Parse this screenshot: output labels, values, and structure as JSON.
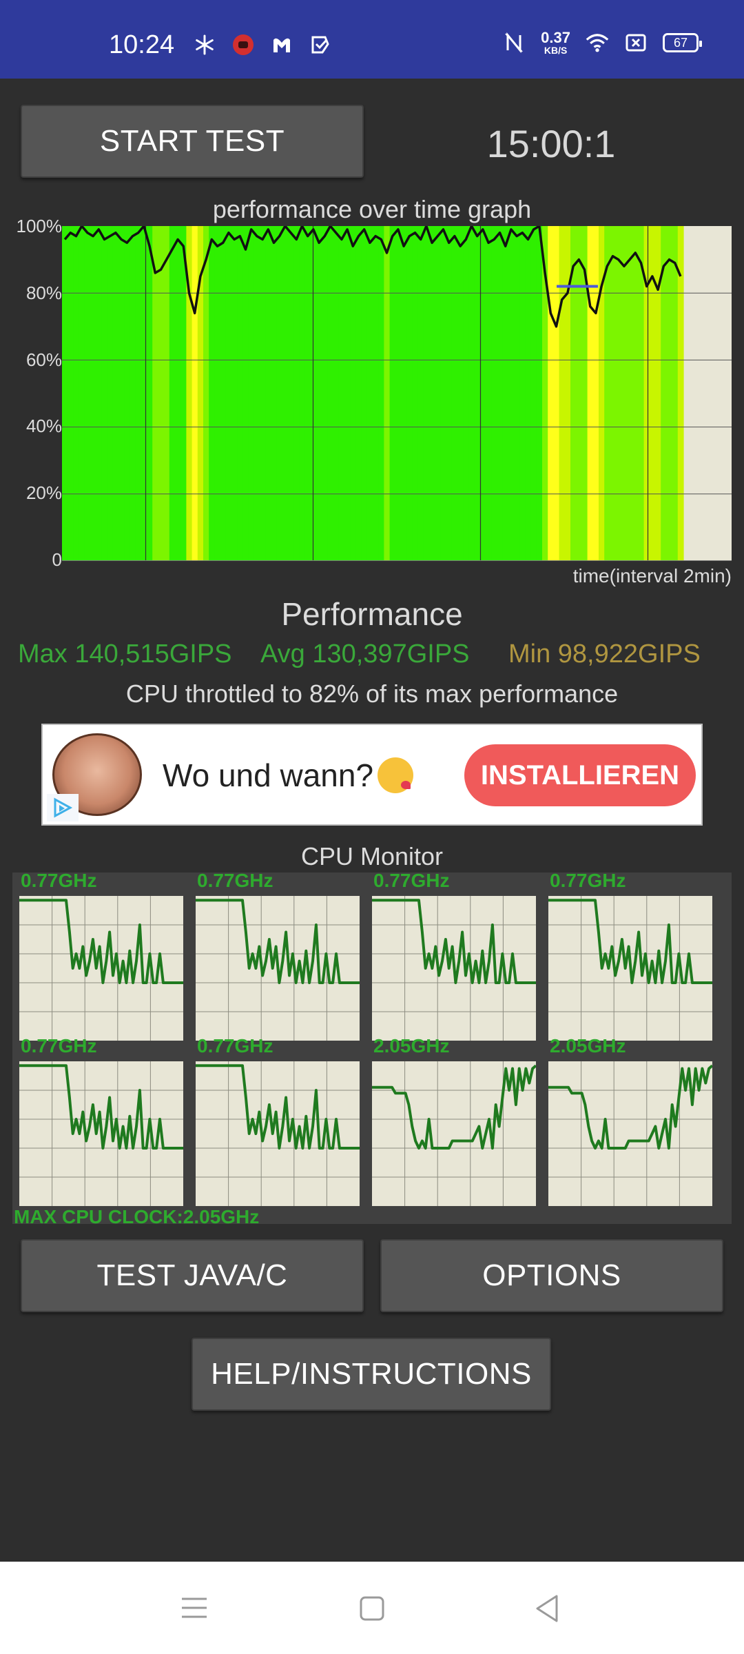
{
  "status_bar": {
    "time": "10:24",
    "net_speed_value": "0.37",
    "net_speed_unit": "KB/S",
    "battery": "67",
    "icons_left": [
      "snowflake-icon",
      "game-icon",
      "malwarebytes-icon",
      "app-check-icon"
    ],
    "icons_right": [
      "nfc-icon",
      "net-speed",
      "wifi-icon",
      "no-sim-icon",
      "battery-icon"
    ]
  },
  "controls": {
    "start_test": "START TEST",
    "timer": "15:00:1",
    "test_java": "TEST JAVA/C",
    "options": "OPTIONS",
    "help": "HELP/INSTRUCTIONS"
  },
  "chart_data": [
    {
      "type": "line",
      "title": "performance over time graph",
      "xlabel": "time(interval 2min)",
      "ylabel": "",
      "yticks": [
        "100%",
        "80%",
        "60%",
        "40%",
        "20%",
        "0"
      ],
      "ylim": [
        0,
        100
      ],
      "x_intervals": 8,
      "series": [
        {
          "values": [
            96,
            98,
            97,
            100,
            98,
            97,
            99,
            96,
            97,
            98,
            96,
            95,
            97,
            98,
            100,
            94,
            86,
            87,
            90,
            93,
            96,
            94,
            80,
            74,
            85,
            90,
            96,
            94,
            95,
            98,
            96,
            97,
            93,
            99,
            97,
            96,
            99,
            95,
            97,
            100,
            98,
            96,
            100,
            97,
            99,
            95,
            97,
            100,
            98,
            96,
            99,
            94,
            97,
            99,
            95,
            97,
            96,
            92,
            97,
            99,
            94,
            97,
            98,
            96,
            100,
            95,
            97,
            99,
            95,
            97,
            94,
            96,
            100,
            97,
            99,
            95,
            96,
            98,
            94,
            99,
            97,
            98,
            96,
            99,
            100,
            86,
            74,
            70,
            78,
            80,
            88,
            90,
            87,
            76,
            74,
            82,
            88,
            91,
            90,
            88,
            90,
            92,
            89,
            82,
            85,
            81,
            88,
            90,
            89,
            85
          ]
        }
      ],
      "throttle_line": 82
    }
  ],
  "performance": {
    "title": "Performance",
    "max": "Max 140,515GIPS",
    "avg": "Avg 130,397GIPS",
    "min": "Min 98,922GIPS",
    "throttle_text": "CPU throttled to 82% of its max performance"
  },
  "ad": {
    "text": "Wo und wann?",
    "emoji": "kiss-emoji",
    "button": "INSTALLIEREN"
  },
  "cpu_monitor": {
    "title": "CPU Monitor",
    "max_clock": "MAX CPU CLOCK:2.05GHz",
    "cores": [
      {
        "freq": "0.77GHz",
        "pattern": "low"
      },
      {
        "freq": "0.77GHz",
        "pattern": "low"
      },
      {
        "freq": "0.77GHz",
        "pattern": "low"
      },
      {
        "freq": "0.77GHz",
        "pattern": "low"
      },
      {
        "freq": "0.77GHz",
        "pattern": "low"
      },
      {
        "freq": "0.77GHz",
        "pattern": "low"
      },
      {
        "freq": "2.05GHz",
        "pattern": "high"
      },
      {
        "freq": "2.05GHz",
        "pattern": "high"
      }
    ]
  },
  "nav": [
    "menu-icon",
    "home-icon",
    "back-icon"
  ],
  "colors": {
    "status_bar": "#2f3a9c",
    "background": "#2e2e2e",
    "button": "#555555",
    "green_text": "#3aa83a",
    "min_text": "#b09640",
    "ad_button": "#f05a5a",
    "graph_bg": "#e8e6d6",
    "cpu_line": "#1f7a1f"
  }
}
